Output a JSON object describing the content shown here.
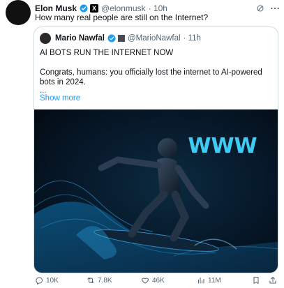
{
  "post": {
    "author_name": "Elon Musk",
    "author_handle": "@elonmusk",
    "time": "· 10h",
    "text": "How many real people are still on the Internet?"
  },
  "quote": {
    "author_name": "Mario Nawfal",
    "author_handle": "@MarioNawfal",
    "time": "· 11h",
    "headline": "AI BOTS RUN THE INTERNET NOW",
    "body": "Congrats, humans: you officially lost the internet to AI-powered bots in 2024.",
    "ellipsis": "...",
    "show_more": "Show more",
    "image_text": "WWW"
  },
  "actions": {
    "replies": "10K",
    "reposts": "7.8K",
    "likes": "46K",
    "views": "11M"
  },
  "colors": {
    "verified": "#1d9bf0",
    "link": "#1d9bf0",
    "muted": "#536471",
    "glow": "#41d6ff"
  }
}
